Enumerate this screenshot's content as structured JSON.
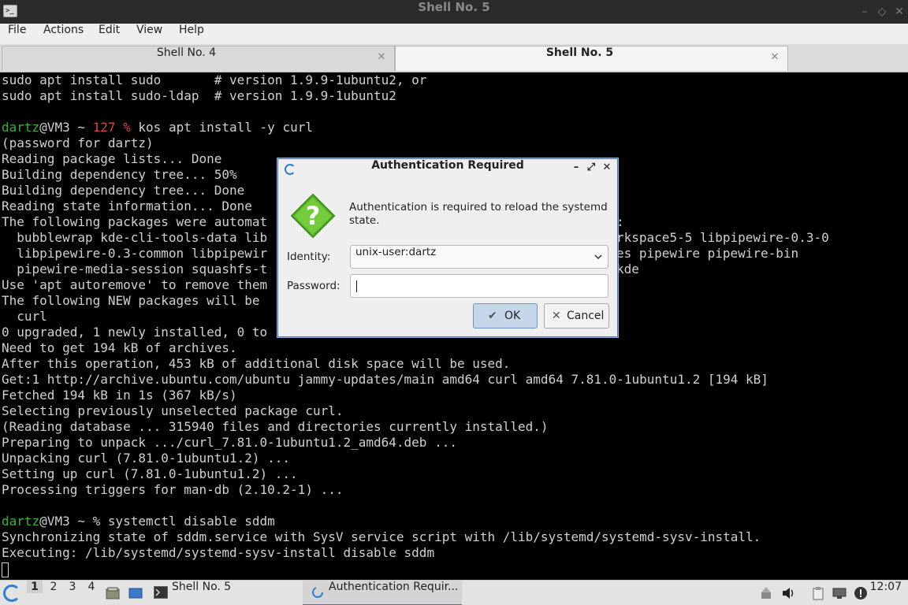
{
  "window": {
    "title": "Shell No. 5",
    "buttons": {
      "minimize": "–",
      "maximize": "◇",
      "close": "✕"
    }
  },
  "menu": [
    "File",
    "Actions",
    "Edit",
    "View",
    "Help"
  ],
  "tabs": [
    {
      "label": "Shell No. 4",
      "active": false
    },
    {
      "label": "Shell No. 5",
      "active": true
    }
  ],
  "terminal": {
    "lines": [
      "sudo apt install sudo       # version 1.9.9-1ubuntu2, or",
      "sudo apt install sudo-ldap  # version 1.9.9-1ubuntu2",
      "",
      "PROMPT_127",
      "(password for dartz)",
      "Reading package lists... Done",
      "Building dependency tree... 50%",
      "Building dependency tree... Done",
      "Reading state information... Done",
      "The following packages were automat",
      "  bubblewrap kde-cli-tools-data lib",
      "  libpipewire-0.3-common libpipewir",
      "  pipewire-media-session squashfs-t",
      "Use 'apt autoremove' to remove them",
      "The following NEW packages will be",
      "  curl",
      "0 upgraded, 1 newly installed, 0 to",
      "Need to get 194 kB of archives.",
      "After this operation, 453 kB of additional disk space will be used.",
      "Get:1 http://archive.ubuntu.com/ubuntu jammy-updates/main amd64 curl amd64 7.81.0-1ubuntu1.2 [194 kB]",
      "Fetched 194 kB in 1s (367 kB/s)",
      "Selecting previously unselected package curl.",
      "(Reading database ... 315940 files and directories currently installed.)",
      "Preparing to unpack .../curl_7.81.0-1ubuntu1.2_amd64.deb ...",
      "Unpacking curl (7.81.0-1ubuntu1.2) ...",
      "Setting up curl (7.81.0-1ubuntu1.2) ...",
      "Processing triggers for man-db (2.10.2-1) ...",
      "",
      "PROMPT_2",
      "Synchronizing state of sddm.service with SysV service script with /lib/systemd/systemd-sysv-install.",
      "Executing: /lib/systemd/systemd-sysv-install disable sddm"
    ],
    "right_fragments": [
      {
        "row": 9,
        "text": ":"
      },
      {
        "row": 10,
        "text": "rkspace5-5 libpipewire-0.3-0"
      },
      {
        "row": 11,
        "text": "es pipewire pipewire-bin"
      },
      {
        "row": 12,
        "text": "kde"
      }
    ],
    "prompt1": {
      "user": "dartz",
      "host": "@VM3 ~ ",
      "code": "127 %",
      "cmd": " kos apt install -y curl"
    },
    "prompt2": {
      "user": "dartz",
      "host": "@VM3 ~ ",
      "sym": "%",
      "cmd": " systemctl disable sddm"
    }
  },
  "dialog": {
    "title": "Authentication Required",
    "buttons": {
      "minimize": "–",
      "restore": "⤢",
      "close": "✕"
    },
    "message": "Authentication is required to reload the systemd state.",
    "identity_label": "Identity:",
    "identity_value": "unix-user:dartz",
    "password_label": "Password:",
    "ok_label": "OK",
    "cancel_label": "Cancel",
    "icon": "question-icon"
  },
  "taskbar": {
    "workspaces": [
      "1",
      "2",
      "3",
      "4"
    ],
    "tasks": [
      {
        "label": "Shell No. 5",
        "icon": "terminal-icon"
      },
      {
        "label": "Authentication Requir...",
        "icon": "auth-icon"
      }
    ],
    "clock": "12:07"
  },
  "colors": {
    "prompt_user": "#3ab23a",
    "prompt_error": "#d84b3b",
    "accent": "#2f7fd0",
    "ok_button": "#c6d6ea"
  }
}
